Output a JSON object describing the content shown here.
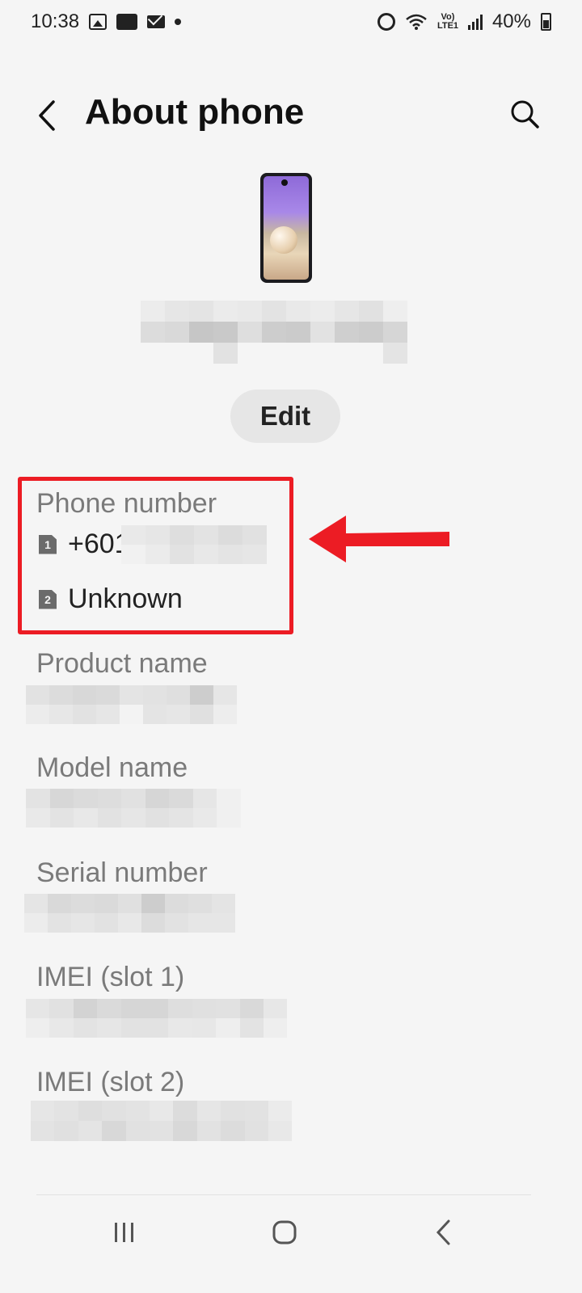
{
  "status_bar": {
    "time": "10:38",
    "battery_text": "40%",
    "network_label": "Vo) LTE1",
    "icons_left": [
      "image-icon",
      "outlook-icon",
      "mail-icon",
      "dot-icon"
    ],
    "icons_right": [
      "alarm-icon",
      "wifi-icon",
      "lte-icon",
      "signal-icon",
      "battery-icon"
    ]
  },
  "header": {
    "title": "About phone",
    "back_icon": "chevron-left-icon",
    "search_icon": "search-icon"
  },
  "device": {
    "name": "",
    "edit_label": "Edit"
  },
  "phone_number": {
    "label": "Phone number",
    "sim1_badge": "1",
    "sim1_value": "+601",
    "sim2_badge": "2",
    "sim2_value": "Unknown"
  },
  "fields": {
    "product_name": "Product name",
    "model_name": "Model name",
    "serial_number": "Serial number",
    "imei_slot1": "IMEI (slot 1)",
    "imei_slot2": "IMEI (slot 2)"
  },
  "annotation": {
    "highlight_color": "#ec1c24"
  },
  "nav": {
    "recents_icon": "recents-icon",
    "home_icon": "home-icon",
    "back_icon": "back-icon"
  }
}
